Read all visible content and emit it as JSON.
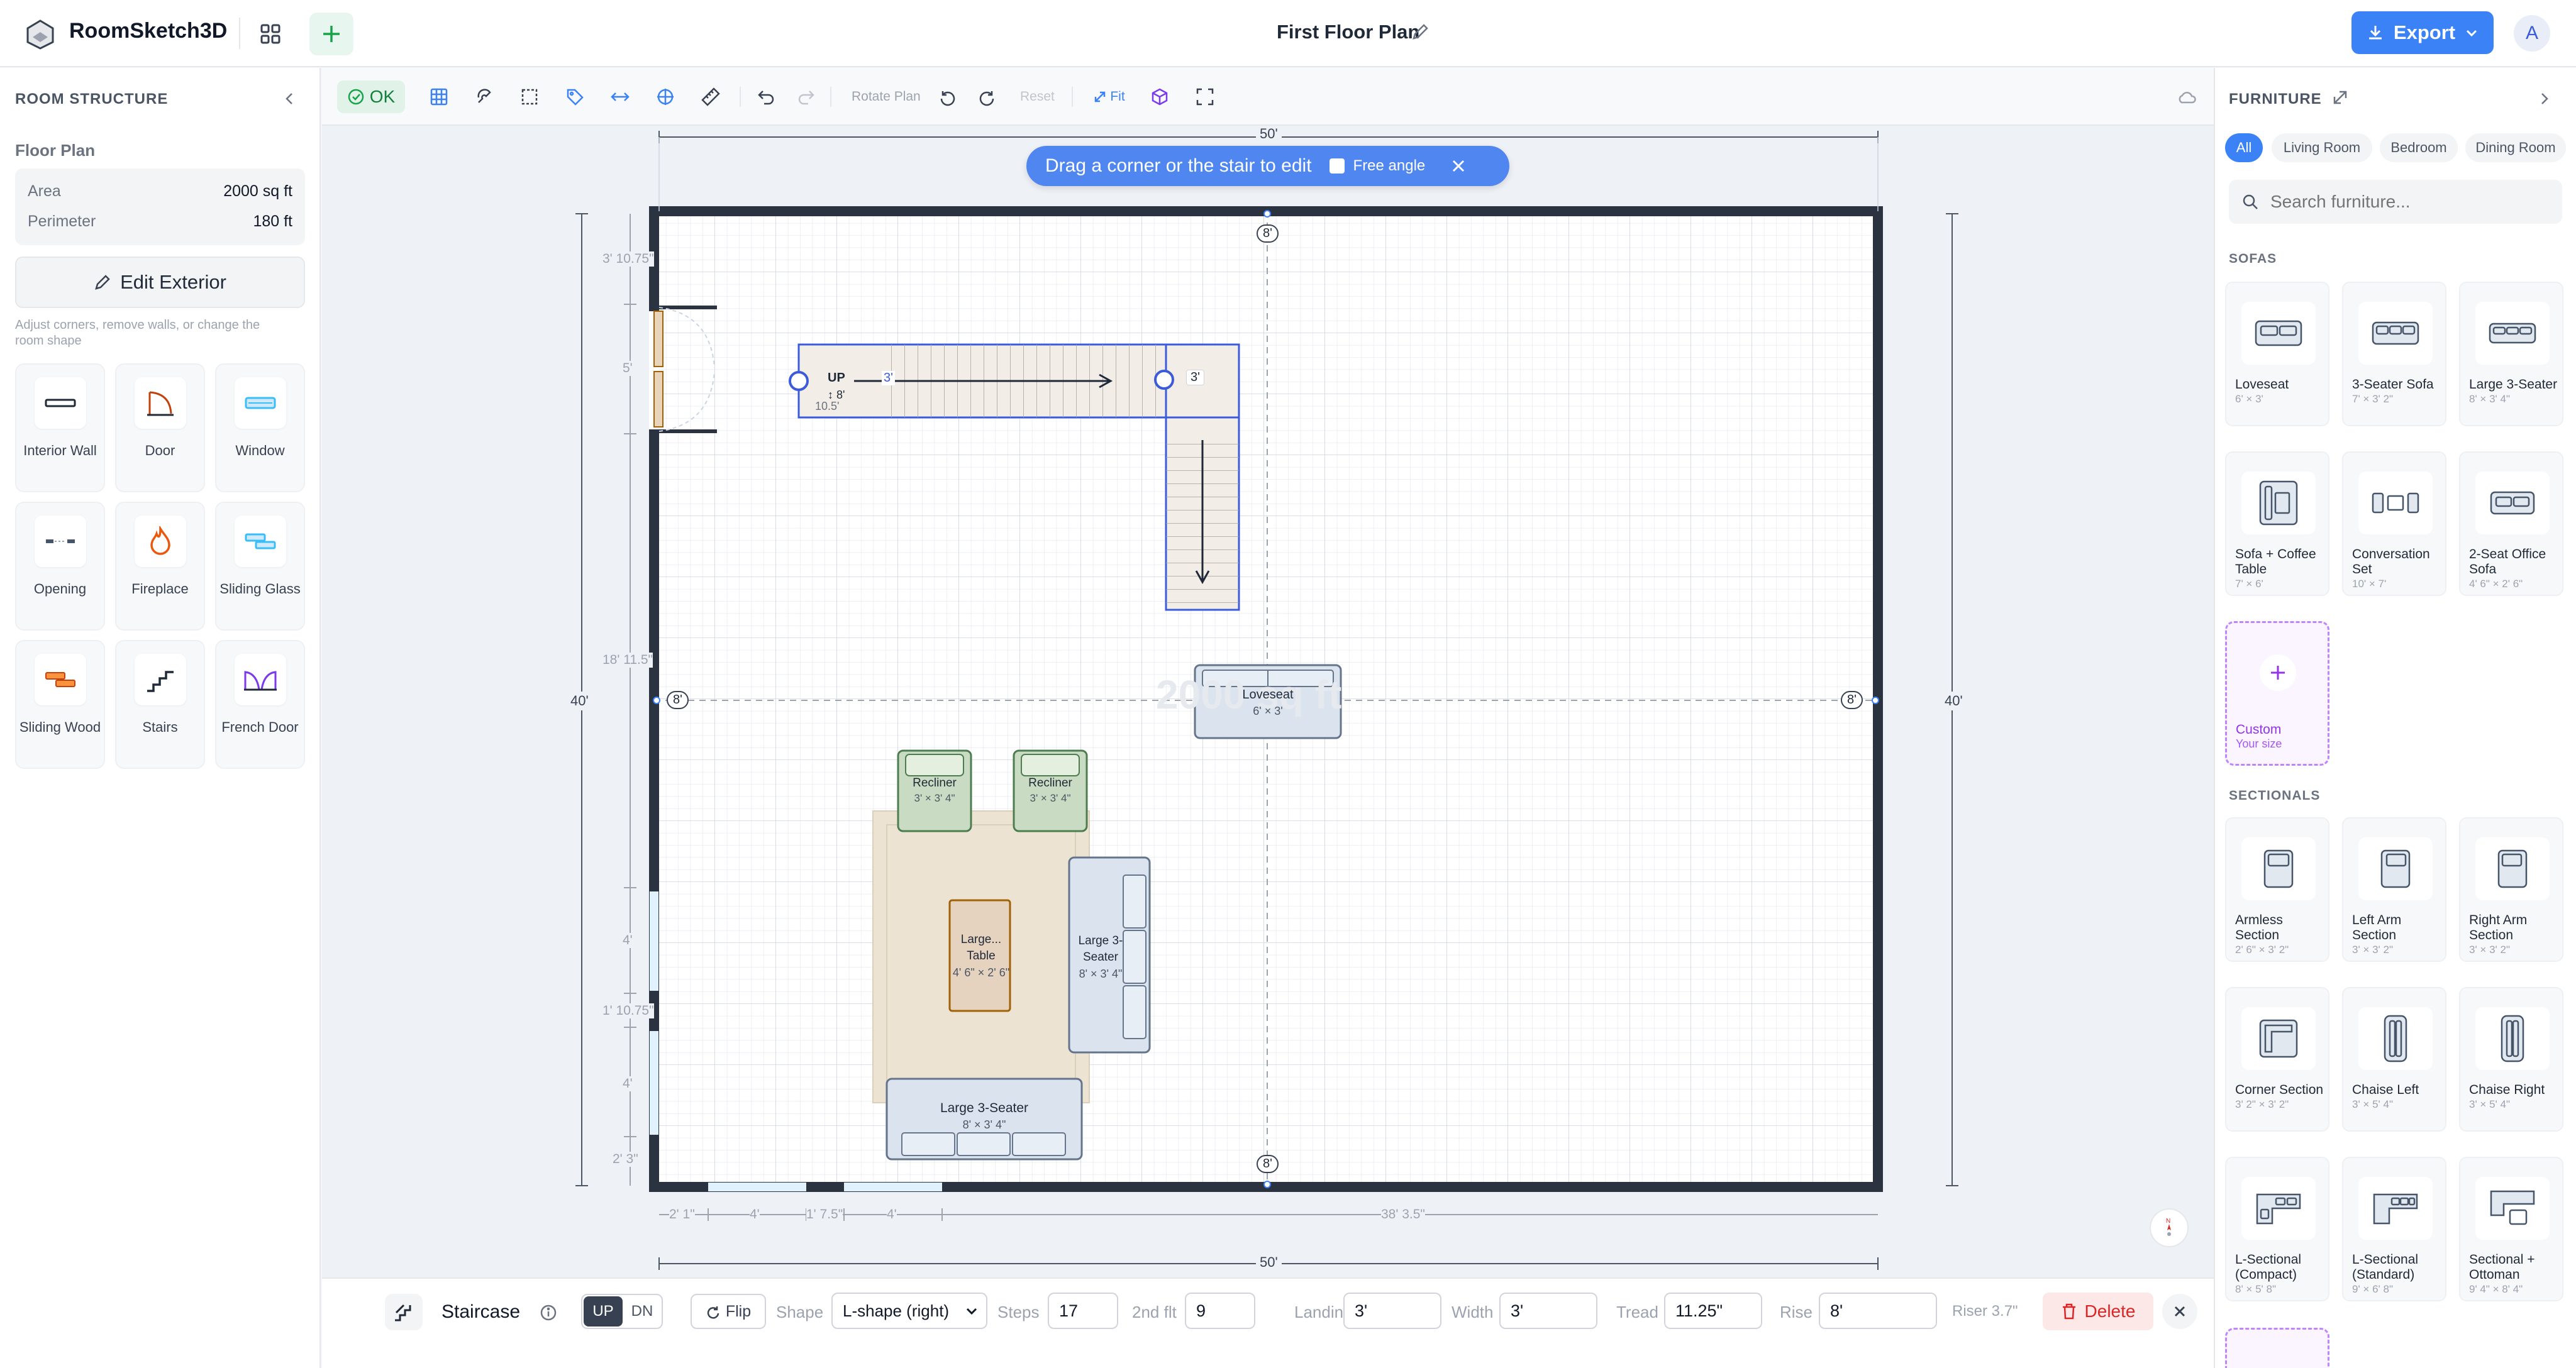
{
  "header": {
    "app_name": "RoomSketch3D",
    "plan_title": "First Floor Plan",
    "export_label": "Export",
    "avatar_initial": "A"
  },
  "left_panel": {
    "section_title": "ROOM STRUCTURE",
    "floor_plan_label": "Floor Plan",
    "area_label": "Area",
    "area_value": "2000 sq ft",
    "perimeter_label": "Perimeter",
    "perimeter_value": "180 ft",
    "edit_exterior_label": "Edit Exterior",
    "edit_hint": "Adjust corners, remove walls, or change the room shape",
    "tools": [
      {
        "label": "Interior Wall",
        "icon": "interior-wall-icon"
      },
      {
        "label": "Door",
        "icon": "door-icon"
      },
      {
        "label": "Window",
        "icon": "window-icon"
      },
      {
        "label": "Opening",
        "icon": "opening-icon"
      },
      {
        "label": "Fireplace",
        "icon": "fireplace-icon"
      },
      {
        "label": "Sliding Glass",
        "icon": "sliding-glass-icon"
      },
      {
        "label": "Sliding Wood",
        "icon": "sliding-wood-icon"
      },
      {
        "label": "Stairs",
        "icon": "stairs-icon"
      },
      {
        "label": "French Door",
        "icon": "french-door-icon"
      }
    ]
  },
  "toolbar": {
    "ok_label": "OK",
    "rotate_plan_label": "Rotate Plan",
    "reset_label": "Reset",
    "fit_label": "Fit"
  },
  "canvas": {
    "toast_text": "Drag a corner or the stair to edit",
    "free_angle_label": "Free angle",
    "area_watermark": "2000 sq ft",
    "dims": {
      "top": "50'",
      "bottom": "50'",
      "left": "40'",
      "right": "40'",
      "mid_top": "8'",
      "mid_bottom": "8'",
      "mid_left": "8'",
      "mid_right": "8'",
      "left_seg_1": "3' 10.75\"",
      "left_seg_2": "5'",
      "left_seg_3": "18' 11.5\"",
      "left_seg_4": "4'",
      "left_seg_5": "1' 10.75\"",
      "left_seg_6": "4'",
      "left_seg_7": "2' 3\"",
      "bottom_seg_1": "2' 1\"",
      "bottom_seg_2": "4'",
      "bottom_seg_3": "1' 7.5\"",
      "bottom_seg_4": "4'",
      "bottom_seg_5": "38' 3.5\""
    },
    "stair": {
      "up_label": "UP",
      "rise_label": "↕ 8'",
      "length_label": "10.5'",
      "width_label_1": "3'",
      "width_label_2": "3'"
    },
    "items": [
      {
        "name": "Loveseat",
        "dims": "6' × 3'"
      },
      {
        "name": "Recliner",
        "dims": "3' × 3' 4\""
      },
      {
        "name": "Recliner",
        "dims": "3' × 3' 4\""
      },
      {
        "name": "Large... Table",
        "dims": "4' 6\" × 2' 6\""
      },
      {
        "name": "Large 3-Seater",
        "dims": "8' × 3' 4\""
      },
      {
        "name": "Large 3-Seater",
        "dims": "8' × 3' 4\""
      }
    ]
  },
  "right_panel": {
    "title": "FURNITURE",
    "chips": [
      "All",
      "Living Room",
      "Bedroom",
      "Dining Room"
    ],
    "search_placeholder": "Search furniture...",
    "sofas_header": "SOFAS",
    "sofas": [
      {
        "name": "Loveseat",
        "dims": "6' × 3'"
      },
      {
        "name": "3-Seater Sofa",
        "dims": "7' × 3' 2\""
      },
      {
        "name": "Large 3-Seater",
        "dims": "8' × 3' 4\""
      },
      {
        "name": "Sofa + Coffee Table",
        "dims": "7' × 6'"
      },
      {
        "name": "Conversation Set",
        "dims": "10' × 7'"
      },
      {
        "name": "2-Seat Office Sofa",
        "dims": "4' 6\" × 2' 6\""
      }
    ],
    "custom_label": "Custom",
    "custom_sub": "Your size",
    "sectionals_header": "SECTIONALS",
    "sectionals": [
      {
        "name": "Armless Section",
        "dims": "2' 6\" × 3' 2\""
      },
      {
        "name": "Left Arm Section",
        "dims": "3' × 3' 2\""
      },
      {
        "name": "Right Arm Section",
        "dims": "3' × 3' 2\""
      },
      {
        "name": "Corner Section",
        "dims": "3' 2\" × 3' 2\""
      },
      {
        "name": "Chaise Left",
        "dims": "3' × 5' 4\""
      },
      {
        "name": "Chaise Right",
        "dims": "3' × 5' 4\""
      },
      {
        "name": "L-Sectional (Compact)",
        "dims": "8' × 5' 8\""
      },
      {
        "name": "L-Sectional (Standard)",
        "dims": "9' × 6' 8\""
      },
      {
        "name": "Sectional + Ottoman",
        "dims": "9' 4\" × 8' 4\""
      }
    ]
  },
  "bottom_bar": {
    "object_label": "Staircase",
    "up_label": "UP",
    "dn_label": "DN",
    "flip_label": "Flip",
    "shape_label": "Shape",
    "shape_value": "L-shape (right)",
    "steps_label": "Steps",
    "steps_value": "17",
    "second_flt_label": "2nd flt",
    "second_flt_value": "9",
    "landing_label": "Landing",
    "landing_value": "3'",
    "width_label": "Width",
    "width_value": "3'",
    "tread_label": "Tread",
    "tread_value": "11.25\"",
    "rise_label": "Rise",
    "rise_value": "8'",
    "riser_text": "Riser 3.7\"",
    "delete_label": "Delete"
  },
  "colors": {
    "accent": "#3b82f6",
    "wall": "#2b3240",
    "stair_outline": "#3b5bdb",
    "furniture_blue": "#b9c8dc",
    "recliner_green": "#bcd4b6",
    "ok_green": "#16a34a",
    "delete_red": "#dc2626",
    "custom_purple": "#9333ea"
  }
}
